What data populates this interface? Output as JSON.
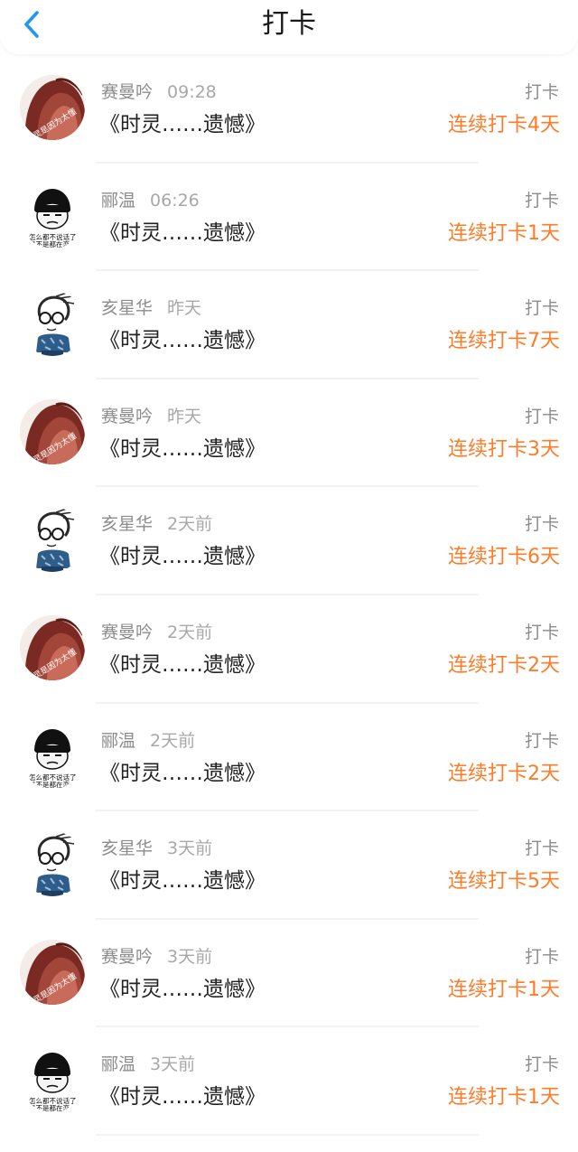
{
  "header": {
    "title": "打卡",
    "back_icon": "chevron-left-icon",
    "accent": "#2196f3"
  },
  "colors": {
    "streak": "#ff7b28",
    "meta": "#8c8c8c"
  },
  "items": [
    {
      "user": "赛曼吟",
      "time": "09:28",
      "note": "《时灵……遗憾》",
      "action": "打卡",
      "streak": "连续打卡4天",
      "avatar": "girl-avatar"
    },
    {
      "user": "郦温",
      "time": "06:26",
      "note": "《时灵……遗憾》",
      "action": "打卡",
      "streak": "连续打卡1天",
      "avatar": "meme-avatar"
    },
    {
      "user": "亥星华",
      "time": "昨天",
      "note": "《时灵……遗憾》",
      "action": "打卡",
      "streak": "连续打卡7天",
      "avatar": "sketch-avatar"
    },
    {
      "user": "赛曼吟",
      "time": "昨天",
      "note": "《时灵……遗憾》",
      "action": "打卡",
      "streak": "连续打卡3天",
      "avatar": "girl-avatar"
    },
    {
      "user": "亥星华",
      "time": "2天前",
      "note": "《时灵……遗憾》",
      "action": "打卡",
      "streak": "连续打卡6天",
      "avatar": "sketch-avatar"
    },
    {
      "user": "赛曼吟",
      "time": "2天前",
      "note": "《时灵……遗憾》",
      "action": "打卡",
      "streak": "连续打卡2天",
      "avatar": "girl-avatar"
    },
    {
      "user": "郦温",
      "time": "2天前",
      "note": "《时灵……遗憾》",
      "action": "打卡",
      "streak": "连续打卡2天",
      "avatar": "meme-avatar"
    },
    {
      "user": "亥星华",
      "time": "3天前",
      "note": "《时灵……遗憾》",
      "action": "打卡",
      "streak": "连续打卡5天",
      "avatar": "sketch-avatar"
    },
    {
      "user": "赛曼吟",
      "time": "3天前",
      "note": "《时灵……遗憾》",
      "action": "打卡",
      "streak": "连续打卡1天",
      "avatar": "girl-avatar"
    },
    {
      "user": "郦温",
      "time": "3天前",
      "note": "《时灵……遗憾》",
      "action": "打卡",
      "streak": "连续打卡1天",
      "avatar": "meme-avatar"
    }
  ]
}
